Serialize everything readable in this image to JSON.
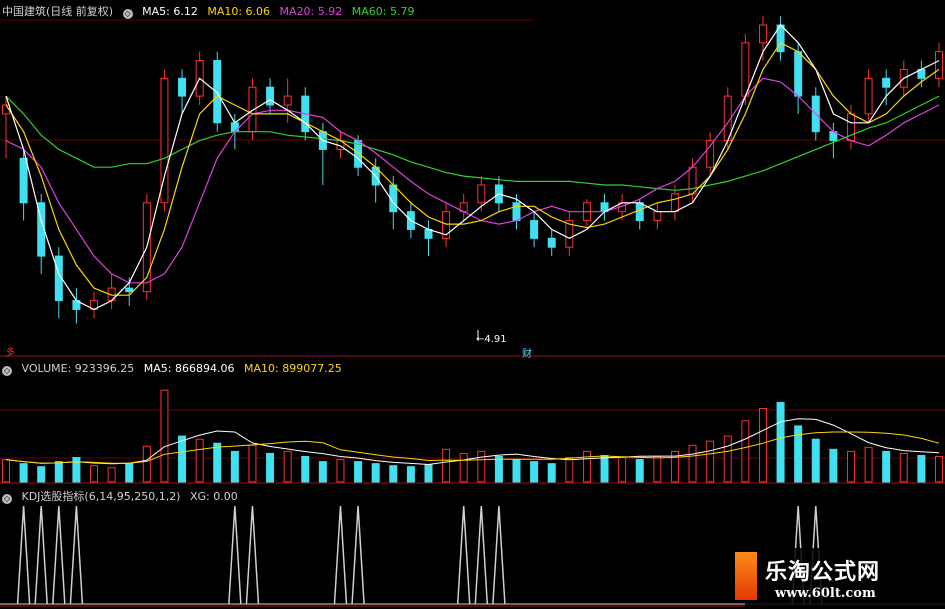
{
  "colors": {
    "up": "#ff3030",
    "down": "#40e0f0",
    "ma5": "#ffffff",
    "ma10": "#ffd700",
    "ma20": "#e040e0",
    "ma60": "#30d030",
    "frame": "#a01010",
    "grid": "#6a0000",
    "kdj": "#d0d0d0"
  },
  "price_panel": {
    "stock": "中国建筑",
    "period": "(日线 前复权)",
    "ma5_label": "MA5:",
    "ma5_value": "6.12",
    "ma10_label": "MA10:",
    "ma10_value": "6.06",
    "ma20_label": "MA20:",
    "ma20_value": "5.92",
    "ma60_label": "MA60:",
    "ma60_value": "5.79",
    "low_label": "4.91",
    "marker_cai": "财",
    "marker_duo": "多"
  },
  "volume_panel": {
    "title": "VOLUME:",
    "value": "923396.25",
    "ma5_label": "MA5:",
    "ma5_value": "866894.06",
    "ma10_label": "MA10:",
    "ma10_value": "899077.25"
  },
  "kdj_panel": {
    "title": "KDJ选股指标(6,14,95,250,1,2)",
    "xg_label": "XG:",
    "xg_value": "0.00"
  },
  "watermark": {
    "name": "乐淘公式网",
    "url": "www.60lt.com"
  },
  "chart_data": [
    {
      "type": "candlestick",
      "ylim": [
        4.8,
        6.6
      ],
      "low_marker": 4.91,
      "ma_lines": {
        "ma20": [
          5.95,
          5.9,
          5.8,
          5.6,
          5.45,
          5.3,
          5.2,
          5.15,
          5.15,
          5.2,
          5.35,
          5.6,
          5.85,
          6.0,
          6.1,
          6.12,
          6.12,
          6.1,
          6.08,
          6.0,
          5.95,
          5.88,
          5.8,
          5.72,
          5.65,
          5.6,
          5.55,
          5.5,
          5.48,
          5.5,
          5.55,
          5.58,
          5.55,
          5.55,
          5.55,
          5.58,
          5.62,
          5.68,
          5.72,
          5.8,
          5.92,
          6.05,
          6.2,
          6.3,
          6.28,
          6.2,
          6.1,
          6.0,
          5.95,
          5.92,
          5.98,
          6.05,
          6.1,
          6.15
        ],
        "ma60": [
          6.2,
          6.1,
          5.98,
          5.9,
          5.85,
          5.8,
          5.8,
          5.82,
          5.82,
          5.85,
          5.9,
          5.95,
          5.98,
          6.0,
          6.0,
          6.0,
          5.98,
          5.97,
          5.96,
          5.95,
          5.93,
          5.9,
          5.87,
          5.83,
          5.8,
          5.77,
          5.75,
          5.74,
          5.73,
          5.72,
          5.72,
          5.72,
          5.72,
          5.71,
          5.7,
          5.7,
          5.69,
          5.68,
          5.67,
          5.68,
          5.7,
          5.72,
          5.75,
          5.78,
          5.82,
          5.86,
          5.9,
          5.94,
          5.98,
          6.02,
          6.05,
          6.1,
          6.15,
          6.2
        ],
        "ma5": [
          6.2,
          5.9,
          5.5,
          5.2,
          5.05,
          5.0,
          5.05,
          5.15,
          5.35,
          5.75,
          6.1,
          6.3,
          6.22,
          6.05,
          6.12,
          6.18,
          6.12,
          6.05,
          5.95,
          5.92,
          5.85,
          5.75,
          5.6,
          5.5,
          5.45,
          5.42,
          5.5,
          5.58,
          5.65,
          5.62,
          5.55,
          5.45,
          5.4,
          5.45,
          5.55,
          5.6,
          5.6,
          5.55,
          5.55,
          5.6,
          5.75,
          5.95,
          6.2,
          6.45,
          6.6,
          6.5,
          6.35,
          6.1,
          6.05,
          6.05,
          6.2,
          6.3,
          6.35,
          6.4
        ],
        "ma10": [
          6.15,
          6.0,
          5.75,
          5.45,
          5.25,
          5.12,
          5.08,
          5.08,
          5.18,
          5.45,
          5.8,
          6.1,
          6.2,
          6.15,
          6.1,
          6.1,
          6.1,
          6.05,
          6.0,
          5.95,
          5.88,
          5.8,
          5.7,
          5.6,
          5.52,
          5.48,
          5.48,
          5.5,
          5.55,
          5.58,
          5.58,
          5.52,
          5.48,
          5.46,
          5.48,
          5.52,
          5.56,
          5.6,
          5.62,
          5.65,
          5.75,
          5.9,
          6.1,
          6.35,
          6.5,
          6.45,
          6.35,
          6.2,
          6.1,
          6.05,
          6.1,
          6.2,
          6.28,
          6.35
        ]
      },
      "candles": [
        [
          6.1,
          6.15,
          5.85,
          6.2
        ],
        [
          5.85,
          5.6,
          5.5,
          5.9
        ],
        [
          5.6,
          5.3,
          5.2,
          5.65
        ],
        [
          5.3,
          5.05,
          4.95,
          5.35
        ],
        [
          5.05,
          5.0,
          4.92,
          5.12
        ],
        [
          5.0,
          5.05,
          4.95,
          5.1
        ],
        [
          5.05,
          5.12,
          5.0,
          5.2
        ],
        [
          5.12,
          5.1,
          5.02,
          5.18
        ],
        [
          5.1,
          5.6,
          5.05,
          5.65
        ],
        [
          5.6,
          6.3,
          5.55,
          6.35
        ],
        [
          6.3,
          6.2,
          6.1,
          6.35
        ],
        [
          6.2,
          6.4,
          6.15,
          6.45
        ],
        [
          6.4,
          6.05,
          6.0,
          6.45
        ],
        [
          6.05,
          6.0,
          5.9,
          6.1
        ],
        [
          6.0,
          6.25,
          5.95,
          6.3
        ],
        [
          6.25,
          6.15,
          6.1,
          6.3
        ],
        [
          6.15,
          6.2,
          6.05,
          6.3
        ],
        [
          6.2,
          6.0,
          5.95,
          6.25
        ],
        [
          6.0,
          5.9,
          5.7,
          6.05
        ],
        [
          5.9,
          5.95,
          5.85,
          6.0
        ],
        [
          5.95,
          5.8,
          5.75,
          5.98
        ],
        [
          5.8,
          5.7,
          5.6,
          5.85
        ],
        [
          5.7,
          5.55,
          5.45,
          5.75
        ],
        [
          5.55,
          5.45,
          5.4,
          5.6
        ],
        [
          5.45,
          5.4,
          5.3,
          5.5
        ],
        [
          5.4,
          5.55,
          5.35,
          5.6
        ],
        [
          5.55,
          5.6,
          5.5,
          5.65
        ],
        [
          5.6,
          5.7,
          5.55,
          5.75
        ],
        [
          5.7,
          5.6,
          5.55,
          5.75
        ],
        [
          5.6,
          5.5,
          5.45,
          5.65
        ],
        [
          5.5,
          5.4,
          5.35,
          5.55
        ],
        [
          5.4,
          5.35,
          5.3,
          5.45
        ],
        [
          5.35,
          5.5,
          5.3,
          5.55
        ],
        [
          5.5,
          5.6,
          5.45,
          5.62
        ],
        [
          5.6,
          5.55,
          5.5,
          5.65
        ],
        [
          5.55,
          5.6,
          5.5,
          5.65
        ],
        [
          5.6,
          5.5,
          5.45,
          5.62
        ],
        [
          5.5,
          5.55,
          5.45,
          5.6
        ],
        [
          5.55,
          5.65,
          5.5,
          5.7
        ],
        [
          5.65,
          5.8,
          5.6,
          5.85
        ],
        [
          5.8,
          5.95,
          5.75,
          6.0
        ],
        [
          5.95,
          6.2,
          5.9,
          6.25
        ],
        [
          6.2,
          6.5,
          6.15,
          6.55
        ],
        [
          6.5,
          6.6,
          6.4,
          6.65
        ],
        [
          6.6,
          6.45,
          6.4,
          6.65
        ],
        [
          6.45,
          6.2,
          6.1,
          6.5
        ],
        [
          6.2,
          6.0,
          5.95,
          6.25
        ],
        [
          6.0,
          5.95,
          5.85,
          6.05
        ],
        [
          5.95,
          6.1,
          5.9,
          6.15
        ],
        [
          6.1,
          6.3,
          6.05,
          6.35
        ],
        [
          6.3,
          6.25,
          6.15,
          6.35
        ],
        [
          6.25,
          6.35,
          6.2,
          6.4
        ],
        [
          6.35,
          6.3,
          6.25,
          6.4
        ],
        [
          6.3,
          6.45,
          6.25,
          6.5
        ]
      ]
    },
    {
      "type": "bar",
      "name": "VOLUME",
      "values": [
        0.22,
        0.18,
        0.15,
        0.2,
        0.24,
        0.16,
        0.14,
        0.18,
        0.35,
        0.9,
        0.45,
        0.42,
        0.38,
        0.3,
        0.36,
        0.28,
        0.3,
        0.25,
        0.2,
        0.22,
        0.2,
        0.18,
        0.16,
        0.15,
        0.17,
        0.32,
        0.28,
        0.3,
        0.25,
        0.22,
        0.2,
        0.18,
        0.24,
        0.3,
        0.26,
        0.24,
        0.22,
        0.25,
        0.3,
        0.36,
        0.4,
        0.45,
        0.6,
        0.72,
        0.78,
        0.55,
        0.42,
        0.32,
        0.3,
        0.34,
        0.3,
        0.28,
        0.26,
        0.25
      ]
    },
    {
      "type": "line",
      "name": "KDJ选股指标",
      "peaks": [
        1,
        2,
        3,
        4,
        13,
        14,
        19,
        20,
        26,
        27,
        28,
        45,
        46
      ]
    }
  ]
}
